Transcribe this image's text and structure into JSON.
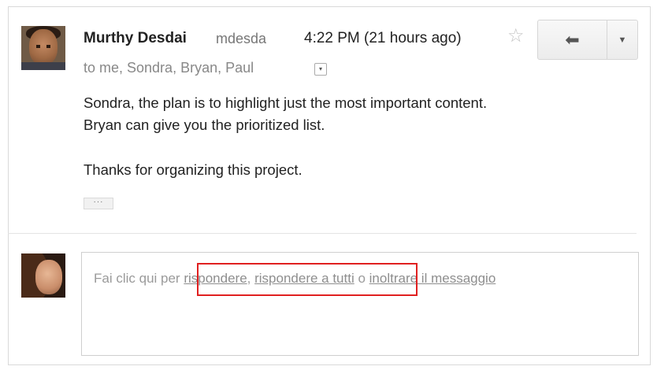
{
  "message": {
    "sender_name": "Murthy Desdai",
    "sender_email": "mdesda",
    "timestamp": "4:22 PM (21 hours ago)",
    "recipients": "to me, Sondra, Bryan, Paul",
    "body": {
      "line1": "Sondra, the plan is to highlight just the most important content.",
      "line2": "Bryan can give you the prioritized list.",
      "line3": "Thanks for organizing this project."
    },
    "collapsed_indicator": "···"
  },
  "icons": {
    "star": "☆",
    "reply": "⬅",
    "more": "▼",
    "details_toggle": "▾"
  },
  "reply_prompt": {
    "prefix": "Fai clic qui per ",
    "reply_link": "rispondere",
    "sep1": ", ",
    "reply_all_link": "rispondere a tutti",
    "sep2": " o ",
    "forward_link": "inoltrare il messaggio"
  },
  "colors": {
    "highlight": "#e02020"
  }
}
